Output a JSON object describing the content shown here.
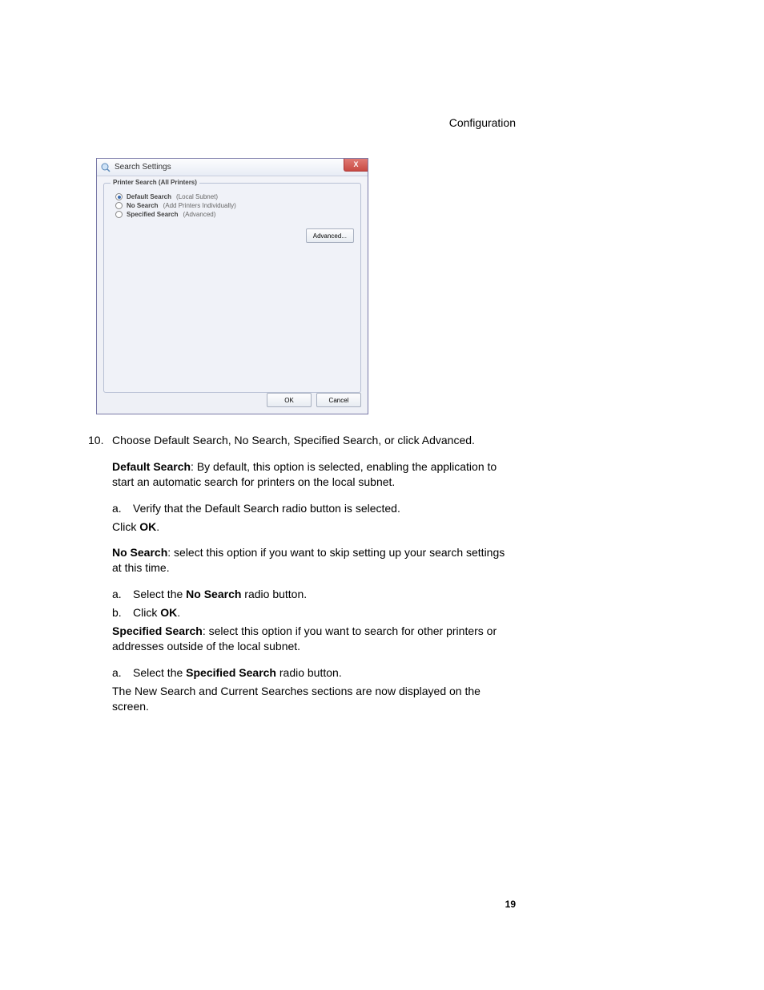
{
  "header": {
    "section": "Configuration"
  },
  "screenshot": {
    "title": "Search Settings",
    "close": "X",
    "group_legend": "Printer Search (All Printers)",
    "radios": [
      {
        "label": "Default Search",
        "desc": "(Local Subnet)",
        "selected": true
      },
      {
        "label": "No Search",
        "desc": "(Add Printers Individually)",
        "selected": false
      },
      {
        "label": "Specified Search",
        "desc": "(Advanced)",
        "selected": false
      }
    ],
    "advanced_btn": "Advanced...",
    "ok_btn": "OK",
    "cancel_btn": "Cancel"
  },
  "body": {
    "step_num": "10.",
    "step_text": "Choose Default Search, No Search, Specified Search, or click Advanced.",
    "ds_head": "Default Search",
    "ds_tail": ": By default, this option is selected, enabling the application to start an automatic search for printers on the local subnet.",
    "ds_a_letter": "a.",
    "ds_a_text": "Verify that the Default Search radio button is selected.",
    "ds_click_pre": "Click ",
    "ok_bold": "OK",
    "period": ".",
    "ns_head": "No Search",
    "ns_tail": ": select this option if you want to skip setting up your search settings at this time.",
    "ns_a_letter": "a.",
    "ns_a_pre": "Select the ",
    "ns_a_bold": "No Search",
    "ns_a_post": " radio button.",
    "ns_b_letter": "b.",
    "ns_b_pre": "Click ",
    "sp_head": "Specified Search",
    "sp_tail": ": select this option if you want to search for other printers or addresses outside of the local subnet.",
    "sp_a_letter": "a.",
    "sp_a_pre": "Select the ",
    "sp_a_bold": "Specified Search",
    "sp_a_post": " radio button.",
    "sp_note": "The New Search and Current Searches sections are now displayed on the screen."
  },
  "footer": {
    "page_number": "19"
  }
}
